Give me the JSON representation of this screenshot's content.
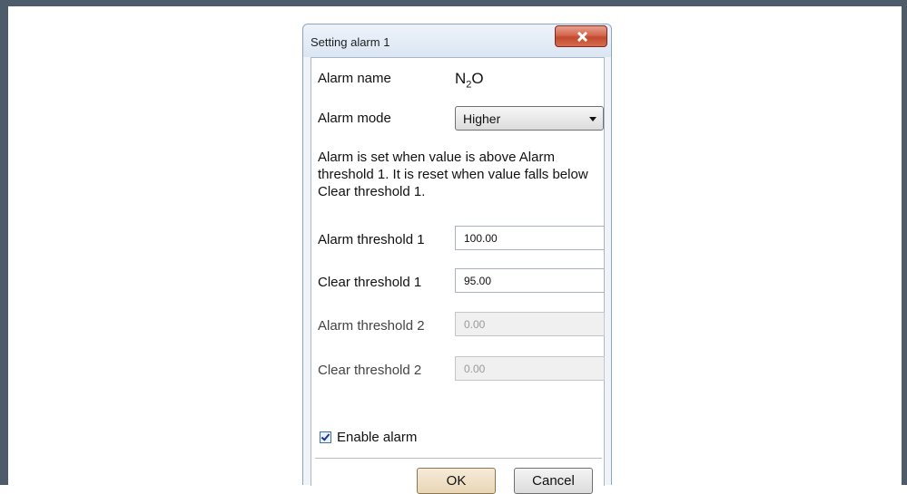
{
  "dialog": {
    "title": "Setting alarm 1",
    "alarm_name_label": "Alarm name",
    "alarm_name_value": {
      "base": "N",
      "sub": "2",
      "tail": "O"
    },
    "alarm_mode_label": "Alarm mode",
    "alarm_mode_value": "Higher",
    "description": "Alarm is set when value is above Alarm threshold 1. It is reset when value falls below Clear threshold 1.",
    "fields": [
      {
        "label": "Alarm threshold 1",
        "value": "100.00",
        "enabled": true
      },
      {
        "label": "Clear threshold 1",
        "value": "95.00",
        "enabled": true
      },
      {
        "label": "Alarm threshold 2",
        "value": "0.00",
        "enabled": false
      },
      {
        "label": "Clear threshold 2",
        "value": "0.00",
        "enabled": false
      }
    ],
    "enable_alarm_label": "Enable alarm",
    "enable_alarm_checked": true,
    "ok_label": "OK",
    "cancel_label": "Cancel"
  },
  "icons": {
    "close": "close-icon",
    "dropdown": "chevron-down-icon",
    "checkbox": "checkmark-icon"
  },
  "colors": {
    "frame": "#4e5b6b",
    "close_button": "#c94f34",
    "ok_button": "#f2e4cc"
  }
}
